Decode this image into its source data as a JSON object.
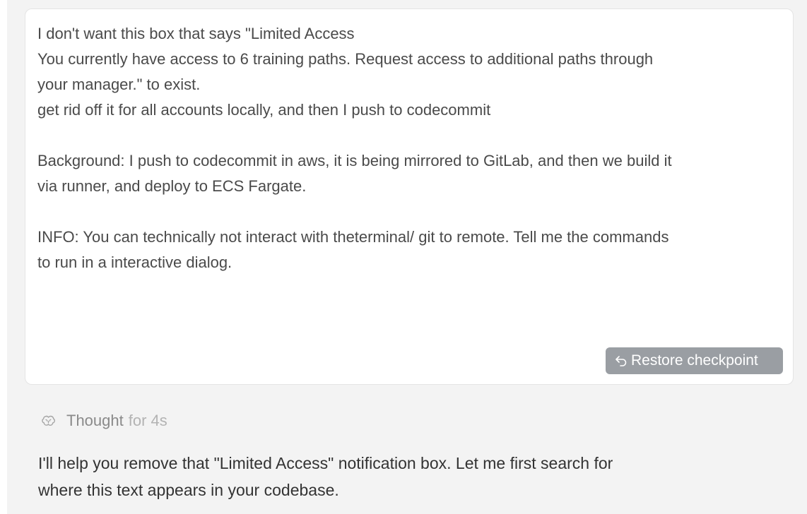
{
  "message": {
    "lines": [
      "I don't want this box that says \"Limited Access",
      "You currently have access to 6 training paths. Request access to additional paths through",
      "your manager.\" to exist.",
      "get rid off it for all accounts locally, and then I push to codecommit",
      "",
      "Background: I push to codecommit in aws, it is being mirrored to GitLab, and then we build it",
      "via runner, and deploy to ECS Fargate.",
      "",
      "INFO: You can technically not interact with theterminal/ git to remote. Tell me the commands",
      "to run in a interactive dialog."
    ],
    "restore_label": "Restore checkpoint",
    "restore_icon": "undo-arrow-icon"
  },
  "thought": {
    "icon": "brain-icon",
    "label": "Thought",
    "duration": "for 4s"
  },
  "reply": {
    "lines": [
      "I'll help you remove that \"Limited Access\" notification box. Let me first search for",
      "where this text appears in your codebase."
    ]
  }
}
